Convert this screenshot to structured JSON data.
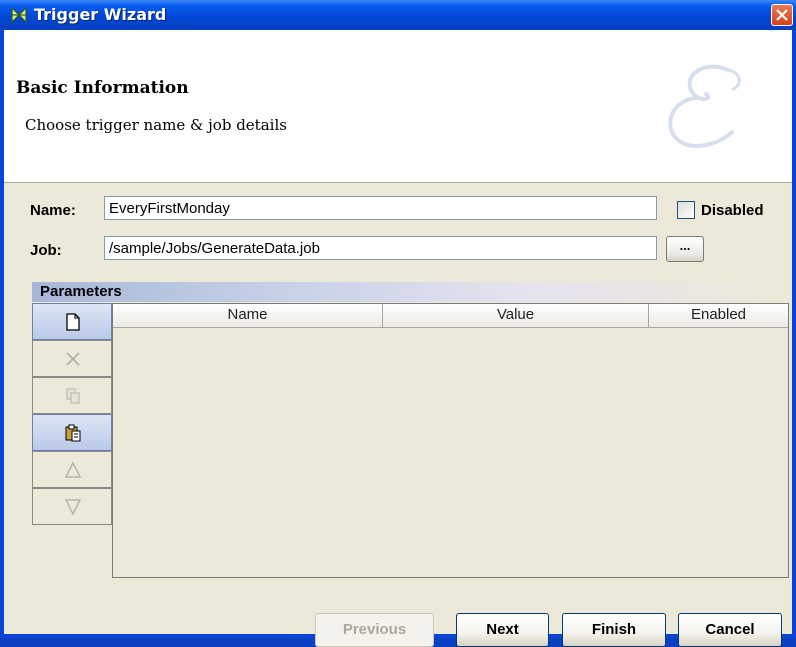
{
  "window": {
    "title": "Trigger Wizard",
    "icon": "trigger-icon",
    "close_icon": "close-icon"
  },
  "header": {
    "title": "Basic Information",
    "subtitle": "Choose trigger name & job details",
    "logo_icon": "script-e-logo-icon"
  },
  "form": {
    "name_label": "Name:",
    "name_value": "EveryFirstMonday",
    "disabled_label": "Disabled",
    "disabled_checked": false,
    "job_label": "Job:",
    "job_value": "/sample/Jobs/GenerateData.job",
    "browse_label": "..."
  },
  "parameters": {
    "title": "Parameters",
    "columns": [
      "Name",
      "Value",
      "Enabled"
    ],
    "rows": [],
    "toolbar": [
      {
        "icon": "new-document-icon",
        "enabled": true
      },
      {
        "icon": "delete-icon",
        "enabled": false
      },
      {
        "icon": "copy-icon",
        "enabled": false
      },
      {
        "icon": "paste-icon",
        "enabled": true
      },
      {
        "icon": "move-up-icon",
        "enabled": false
      },
      {
        "icon": "move-down-icon",
        "enabled": false
      }
    ]
  },
  "buttons": {
    "previous": "Previous",
    "next": "Next",
    "finish": "Finish",
    "cancel": "Cancel",
    "previous_enabled": false
  },
  "colors": {
    "titlebar": "#0047d8",
    "panel": "#ece9d8",
    "header_bg": "#ffffff"
  }
}
